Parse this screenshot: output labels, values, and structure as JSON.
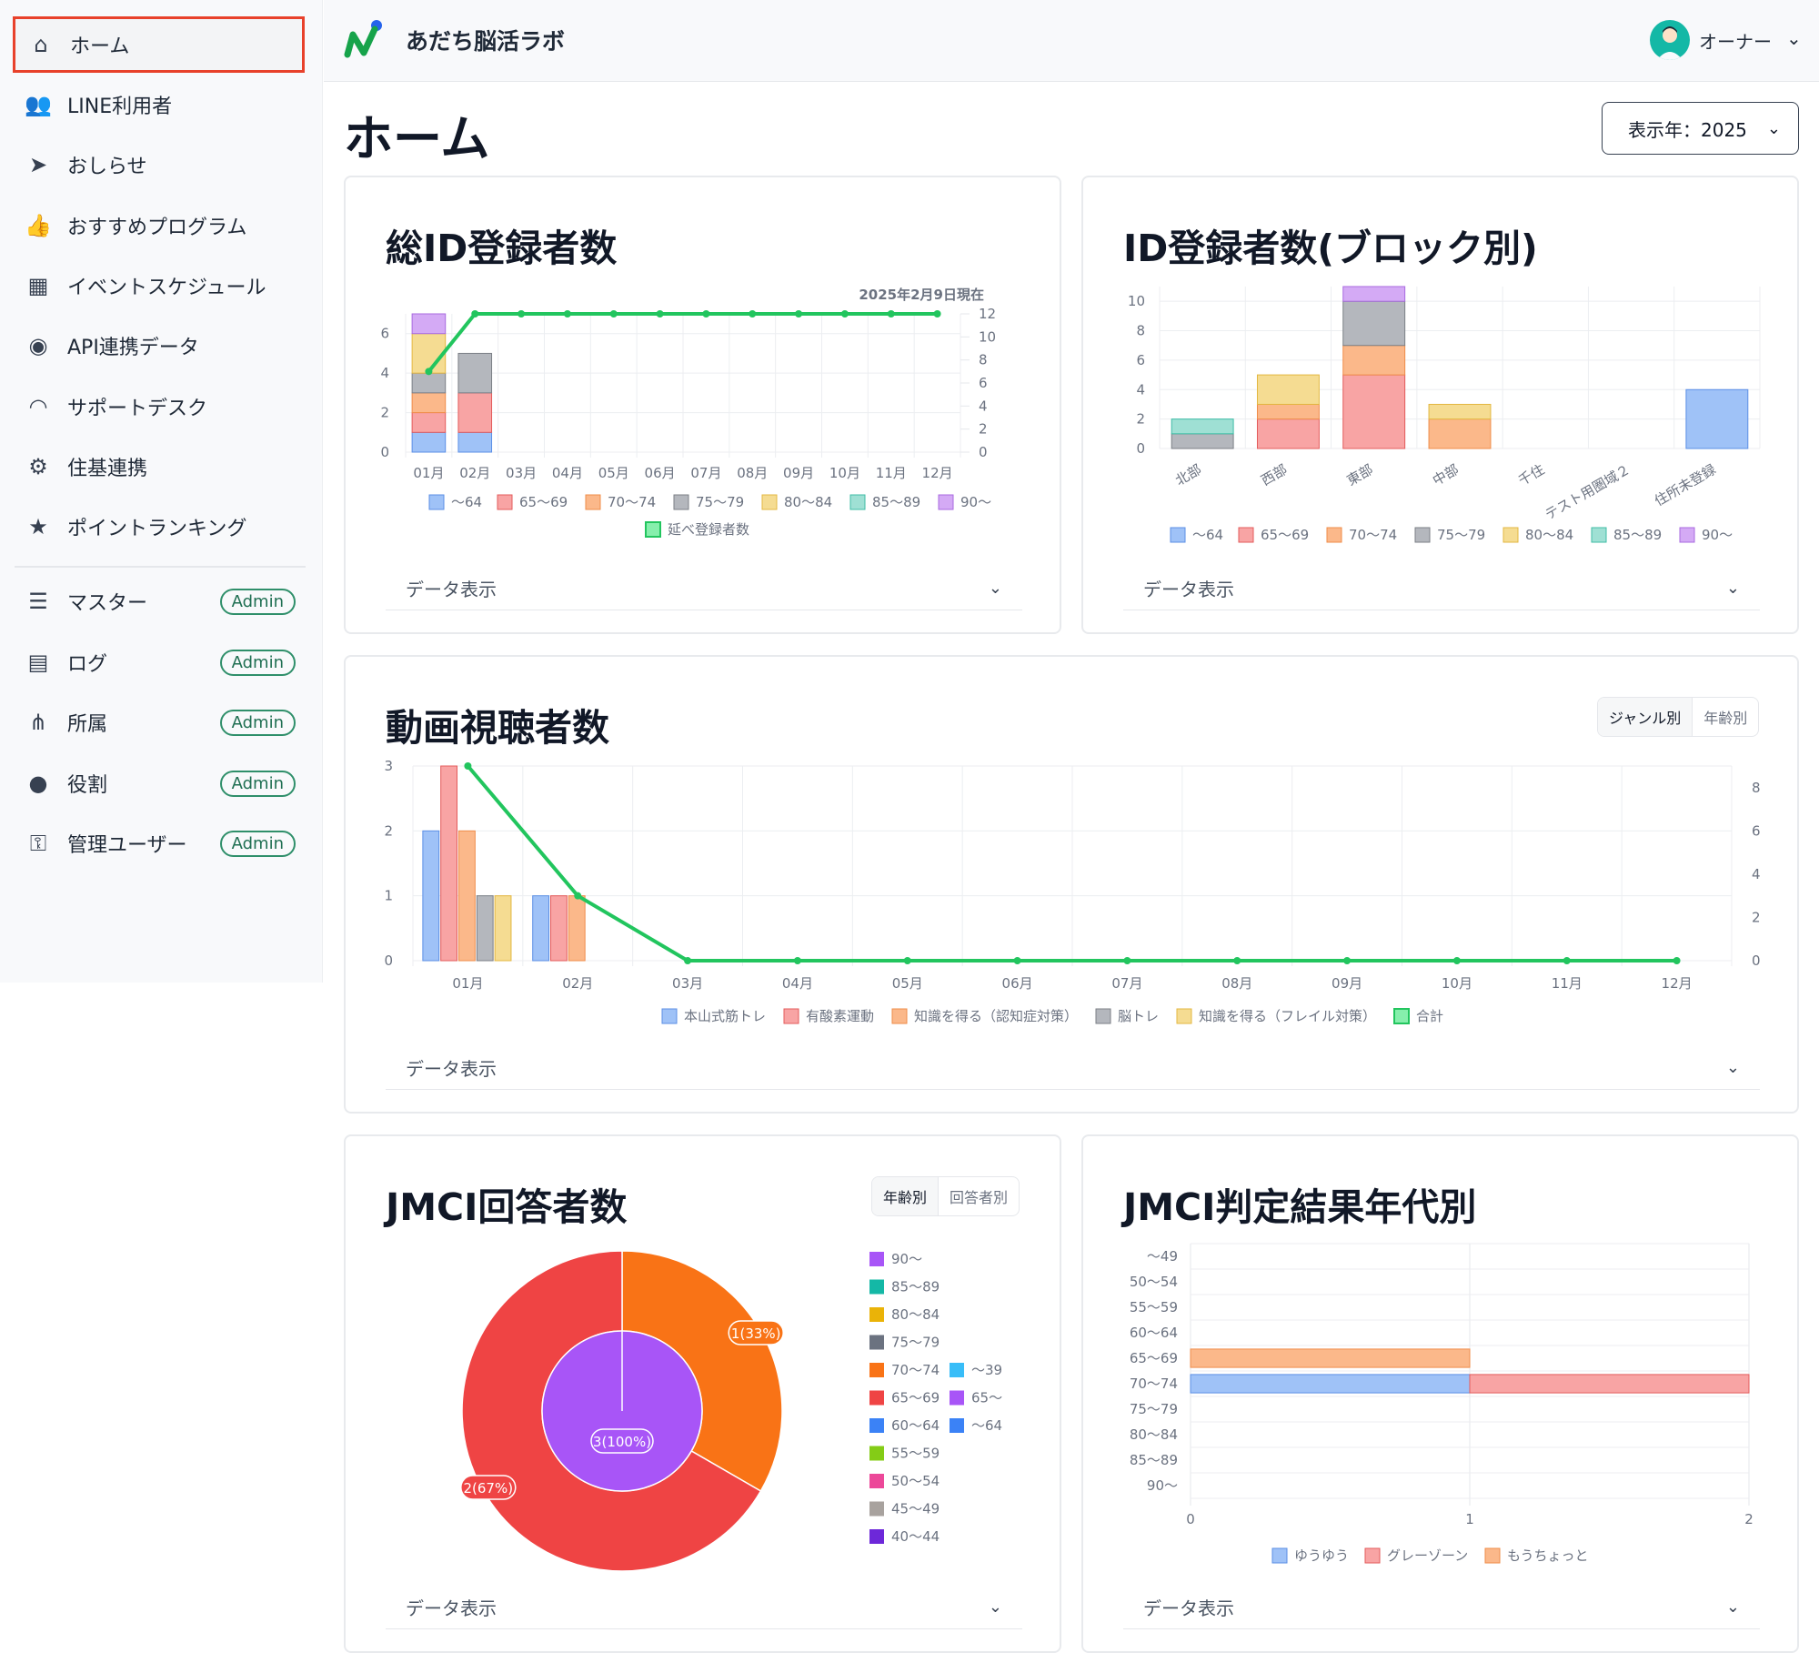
{
  "header": {
    "app_name": "あだち脳活ラボ",
    "user_name": "オーナー"
  },
  "sidebar": {
    "items": [
      {
        "label": "ホーム",
        "icon": "home-icon",
        "active": true,
        "badge": ""
      },
      {
        "label": "LINE利用者",
        "icon": "users-icon",
        "badge": ""
      },
      {
        "label": "おしらせ",
        "icon": "paper-plane-icon",
        "badge": ""
      },
      {
        "label": "おすすめプログラム",
        "icon": "thumbs-up-icon",
        "badge": ""
      },
      {
        "label": "イベントスケジュール",
        "icon": "calendar-icon",
        "badge": ""
      },
      {
        "label": "API連携データ",
        "icon": "api-icon",
        "badge": ""
      },
      {
        "label": "サポートデスク",
        "icon": "headset-icon",
        "badge": ""
      },
      {
        "label": "住基連携",
        "icon": "user-gear-icon",
        "badge": ""
      },
      {
        "label": "ポイントランキング",
        "icon": "star-icon",
        "badge": ""
      },
      {
        "label": "マスター",
        "icon": "table-icon",
        "badge": "Admin"
      },
      {
        "label": "ログ",
        "icon": "log-icon",
        "badge": "Admin"
      },
      {
        "label": "所属",
        "icon": "org-icon",
        "badge": "Admin"
      },
      {
        "label": "役割",
        "icon": "award-icon",
        "badge": "Admin"
      },
      {
        "label": "管理ユーザー",
        "icon": "user-lock-icon",
        "badge": "Admin"
      }
    ]
  },
  "page": {
    "title": "ホーム",
    "year_select": "表示年：2025"
  },
  "common": {
    "data_toggle": "データ表示"
  },
  "colors": {
    "blue": "#9fc2f7",
    "red": "#f8a4a4",
    "orange": "#fbb88a",
    "gray": "#b4b7bd",
    "yellow": "#f5dc92",
    "teal": "#9fe0d4",
    "purple": "#d4aaf5",
    "green": "#22c55e"
  },
  "chart_data": [
    {
      "id": "total-id",
      "type": "bar",
      "title": "総ID登録者数",
      "annotation": "2025年2月9日現在",
      "categories": [
        "01月",
        "02月",
        "03月",
        "04月",
        "05月",
        "06月",
        "07月",
        "08月",
        "09月",
        "10月",
        "11月",
        "12月"
      ],
      "stacked": true,
      "ylim": [
        0,
        7
      ],
      "yticks": [
        "0",
        "2",
        "4",
        "6"
      ],
      "y2lim": [
        0,
        12
      ],
      "y2ticks": [
        "0",
        "2",
        "4",
        "6",
        "8",
        "10",
        "12"
      ],
      "series": [
        {
          "name": "〜64",
          "values": [
            1,
            1,
            0,
            0,
            0,
            0,
            0,
            0,
            0,
            0,
            0,
            0
          ]
        },
        {
          "name": "65〜69",
          "values": [
            1,
            2,
            0,
            0,
            0,
            0,
            0,
            0,
            0,
            0,
            0,
            0
          ]
        },
        {
          "name": "70〜74",
          "values": [
            1,
            0,
            0,
            0,
            0,
            0,
            0,
            0,
            0,
            0,
            0,
            0
          ]
        },
        {
          "name": "75〜79",
          "values": [
            1,
            2,
            0,
            0,
            0,
            0,
            0,
            0,
            0,
            0,
            0,
            0
          ]
        },
        {
          "name": "80〜84",
          "values": [
            2,
            0,
            0,
            0,
            0,
            0,
            0,
            0,
            0,
            0,
            0,
            0
          ]
        },
        {
          "name": "85〜89",
          "values": [
            0,
            0,
            0,
            0,
            0,
            0,
            0,
            0,
            0,
            0,
            0,
            0
          ]
        },
        {
          "name": "90〜",
          "values": [
            1,
            0,
            0,
            0,
            0,
            0,
            0,
            0,
            0,
            0,
            0,
            0
          ]
        }
      ],
      "line": {
        "name": "延べ登録者数",
        "values": [
          7,
          12,
          12,
          12,
          12,
          12,
          12,
          12,
          12,
          12,
          12,
          12
        ]
      }
    },
    {
      "id": "block-id",
      "type": "bar",
      "title": "ID登録者数(ブロック別)",
      "categories": [
        "北部",
        "西部",
        "東部",
        "中部",
        "千住",
        "テスト用圏域２",
        "住所未登録"
      ],
      "stacked": true,
      "ylim": [
        0,
        11
      ],
      "yticks": [
        "0",
        "2",
        "4",
        "6",
        "8",
        "10"
      ],
      "series": [
        {
          "name": "〜64",
          "values": [
            0,
            0,
            0,
            0,
            0,
            0,
            4
          ]
        },
        {
          "name": "65〜69",
          "values": [
            0,
            2,
            5,
            0,
            0,
            0,
            0
          ]
        },
        {
          "name": "70〜74",
          "values": [
            0,
            1,
            2,
            2,
            0,
            0,
            0
          ]
        },
        {
          "name": "75〜79",
          "values": [
            1,
            0,
            3,
            0,
            0,
            0,
            0
          ]
        },
        {
          "name": "80〜84",
          "values": [
            0,
            2,
            0,
            1,
            0,
            0,
            0
          ]
        },
        {
          "name": "85〜89",
          "values": [
            1,
            0,
            0,
            0,
            0,
            0,
            0
          ]
        },
        {
          "name": "90〜",
          "values": [
            0,
            0,
            1,
            0,
            0,
            0,
            0
          ]
        }
      ]
    },
    {
      "id": "video",
      "type": "bar",
      "title": "動画視聴者数",
      "categories": [
        "01月",
        "02月",
        "03月",
        "04月",
        "05月",
        "06月",
        "07月",
        "08月",
        "09月",
        "10月",
        "11月",
        "12月"
      ],
      "stacked": false,
      "ylim": [
        0,
        3
      ],
      "yticks": [
        "0",
        "1",
        "2",
        "3"
      ],
      "y2lim": [
        0,
        9
      ],
      "y2ticks": [
        "0",
        "2",
        "4",
        "6",
        "8"
      ],
      "series": [
        {
          "name": "本山式筋トレ",
          "values": [
            2,
            1,
            0,
            0,
            0,
            0,
            0,
            0,
            0,
            0,
            0,
            0
          ]
        },
        {
          "name": "有酸素運動",
          "values": [
            3,
            1,
            0,
            0,
            0,
            0,
            0,
            0,
            0,
            0,
            0,
            0
          ]
        },
        {
          "name": "知識を得る（認知症対策）",
          "values": [
            2,
            1,
            0,
            0,
            0,
            0,
            0,
            0,
            0,
            0,
            0,
            0
          ]
        },
        {
          "name": "脳トレ",
          "values": [
            1,
            0,
            0,
            0,
            0,
            0,
            0,
            0,
            0,
            0,
            0,
            0
          ]
        },
        {
          "name": "知識を得る（フレイル対策）",
          "values": [
            1,
            0,
            0,
            0,
            0,
            0,
            0,
            0,
            0,
            0,
            0,
            0
          ]
        }
      ],
      "line": {
        "name": "合計",
        "values": [
          9,
          3,
          0,
          0,
          0,
          0,
          0,
          0,
          0,
          0,
          0,
          0
        ]
      },
      "tabs": [
        "ジャンル別",
        "年齢別"
      ]
    },
    {
      "id": "jmci",
      "type": "pie",
      "title": "JMCI回答者数",
      "tabs": [
        "年齢別",
        "回答者別"
      ],
      "outer": [
        {
          "name": "70〜74",
          "value": 1,
          "label": "1(33%)",
          "color": "#f97316"
        },
        {
          "name": "65〜69",
          "value": 2,
          "label": "2(67%)",
          "color": "#ef4444"
        }
      ],
      "inner": [
        {
          "name": "65〜",
          "value": 3,
          "label": "3(100%)",
          "color": "#a855f7"
        }
      ],
      "legend_col1": [
        {
          "name": "90〜",
          "color": "#a855f7"
        },
        {
          "name": "85〜89",
          "color": "#14b8a6"
        },
        {
          "name": "80〜84",
          "color": "#eab308"
        },
        {
          "name": "75〜79",
          "color": "#6b7280"
        },
        {
          "name": "70〜74",
          "color": "#f97316"
        },
        {
          "name": "65〜69",
          "color": "#ef4444"
        },
        {
          "name": "60〜64",
          "color": "#3b82f6"
        },
        {
          "name": "55〜59",
          "color": "#84cc16"
        },
        {
          "name": "50〜54",
          "color": "#ec4899"
        },
        {
          "name": "45〜49",
          "color": "#a8a29e"
        },
        {
          "name": "40〜44",
          "color": "#6d28d9"
        }
      ],
      "legend_col2": [
        {
          "name": "〜39",
          "color": "#38bdf8"
        },
        {
          "name": "65〜",
          "color": "#a855f7"
        },
        {
          "name": "〜64",
          "color": "#3b82f6"
        }
      ]
    },
    {
      "id": "jmci-result",
      "type": "bar",
      "orientation": "horizontal",
      "title": "JMCI判定結果年代別",
      "categories": [
        "〜49",
        "50〜54",
        "55〜59",
        "60〜64",
        "65〜69",
        "70〜74",
        "75〜79",
        "80〜84",
        "85〜89",
        "90〜"
      ],
      "xlim": [
        0,
        2
      ],
      "xticks": [
        "0",
        "1",
        "2"
      ],
      "stacked": true,
      "series": [
        {
          "name": "ゆうゆう",
          "values": [
            0,
            0,
            0,
            0,
            0,
            1,
            0,
            0,
            0,
            0
          ]
        },
        {
          "name": "グレーゾーン",
          "values": [
            0,
            0,
            0,
            0,
            0,
            1,
            0,
            0,
            0,
            0
          ]
        },
        {
          "name": "もうちょっと",
          "values": [
            0,
            0,
            0,
            0,
            1,
            0,
            0,
            0,
            0,
            0
          ]
        }
      ]
    }
  ]
}
